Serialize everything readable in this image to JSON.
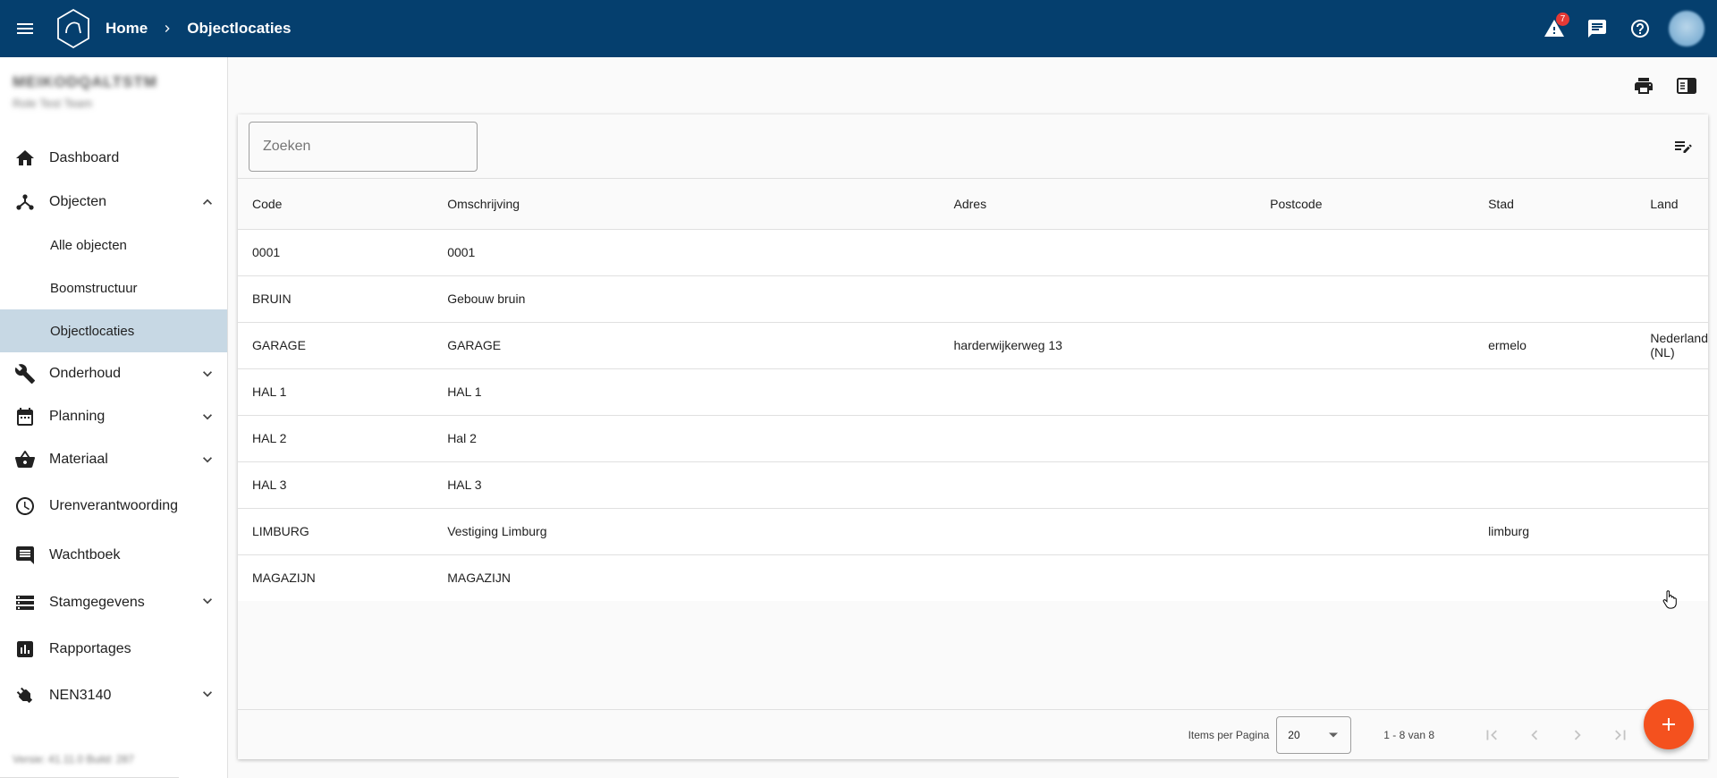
{
  "header": {
    "breadcrumb": {
      "home": "Home",
      "current": "Objectlocaties"
    },
    "alerts_count": "7",
    "icons": [
      "menu-icon",
      "app-logo",
      "warning-icon",
      "chat-icon",
      "help-icon",
      "avatar"
    ],
    "color": "#053f6e"
  },
  "sidebar": {
    "user_name": "MEIKODQALTSTM",
    "user_role": "Role Test Team",
    "items": [
      {
        "label": "Dashboard",
        "icon": "home-icon"
      },
      {
        "label": "Objecten",
        "icon": "hub-icon",
        "expanded": true,
        "children": [
          {
            "label": "Alle objecten"
          },
          {
            "label": "Boomstructuur"
          },
          {
            "label": "Objectlocaties",
            "active": true
          }
        ]
      },
      {
        "label": "Onderhoud",
        "icon": "wrench-icon"
      },
      {
        "label": "Planning",
        "icon": "calendar-icon"
      },
      {
        "label": "Materiaal",
        "icon": "basket-icon"
      },
      {
        "label": "Urenverantwoording",
        "icon": "clock-icon"
      },
      {
        "label": "Wachtboek",
        "icon": "comment-icon"
      },
      {
        "label": "Stamgegevens",
        "icon": "storage-icon"
      },
      {
        "label": "Rapportages",
        "icon": "chart-icon"
      },
      {
        "label": "NEN3140",
        "icon": "plug-icon"
      }
    ],
    "version": "Versie: 41.11.0 Build: 287"
  },
  "toolbar": {
    "search_placeholder": "Zoeken"
  },
  "table": {
    "columns": [
      "Code",
      "Omschrijving",
      "Adres",
      "Postcode",
      "Stad",
      "Land"
    ],
    "rows": [
      [
        "0001",
        "0001",
        "",
        "",
        "",
        ""
      ],
      [
        "BRUIN",
        "Gebouw bruin",
        "",
        "",
        "",
        ""
      ],
      [
        "GARAGE",
        "GARAGE",
        "harderwijkerweg 13",
        "",
        "ermelo",
        "Nederland (NL)"
      ],
      [
        "HAL 1",
        "HAL 1",
        "",
        "",
        "",
        ""
      ],
      [
        "HAL 2",
        "Hal 2",
        "",
        "",
        "",
        ""
      ],
      [
        "HAL 3",
        "HAL 3",
        "",
        "",
        "",
        ""
      ],
      [
        "LIMBURG",
        "Vestiging Limburg",
        "",
        "",
        "limburg",
        ""
      ],
      [
        "MAGAZIJN",
        "MAGAZIJN",
        "",
        "",
        "",
        ""
      ]
    ]
  },
  "paginator": {
    "items_per_page_label": "Items per Pagina",
    "items_per_page": "20",
    "range_label": "1 - 8 van 8"
  },
  "fab": {
    "icon": "plus-icon",
    "color": "#f4511e"
  }
}
